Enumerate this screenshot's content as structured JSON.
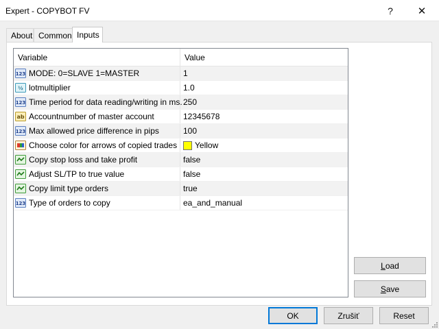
{
  "window": {
    "title": "Expert - COPYBOT FV",
    "help_glyph": "?",
    "close_glyph": "✕"
  },
  "tabs": [
    {
      "label": "About"
    },
    {
      "label": "Common"
    },
    {
      "label": "Inputs",
      "active": true
    }
  ],
  "grid": {
    "headers": {
      "variable": "Variable",
      "value": "Value"
    },
    "rows": [
      {
        "icon": "integer-icon",
        "variable": "MODE: 0=SLAVE 1=MASTER",
        "value": "1"
      },
      {
        "icon": "double-icon",
        "variable": "lotmultiplier",
        "value": "1.0"
      },
      {
        "icon": "integer-icon",
        "variable": "Time period for data reading/writing in ms.",
        "value": "250"
      },
      {
        "icon": "string-icon",
        "variable": "Accountnumber of master account",
        "value": "12345678"
      },
      {
        "icon": "integer-icon",
        "variable": "Max allowed price difference in pips",
        "value": "100"
      },
      {
        "icon": "color-icon",
        "variable": "Choose color for arrows of copied trades",
        "value": "Yellow",
        "swatch": "#ffff00"
      },
      {
        "icon": "bool-icon",
        "variable": "Copy stop loss and take profit",
        "value": "false"
      },
      {
        "icon": "bool-icon",
        "variable": "Adjust SL/TP to true value",
        "value": "false"
      },
      {
        "icon": "bool-icon",
        "variable": "Copy limit type orders",
        "value": "true"
      },
      {
        "icon": "integer-icon",
        "variable": "Type of orders to copy",
        "value": "ea_and_manual"
      }
    ]
  },
  "buttons": {
    "load_first": "L",
    "load_rest": "oad",
    "save_first": "S",
    "save_rest": "ave",
    "ok": "OK",
    "cancel": "Zrušiť",
    "reset": "Reset"
  },
  "colors": {
    "accent": "#0078d7",
    "swatch_yellow": "#ffff00"
  }
}
